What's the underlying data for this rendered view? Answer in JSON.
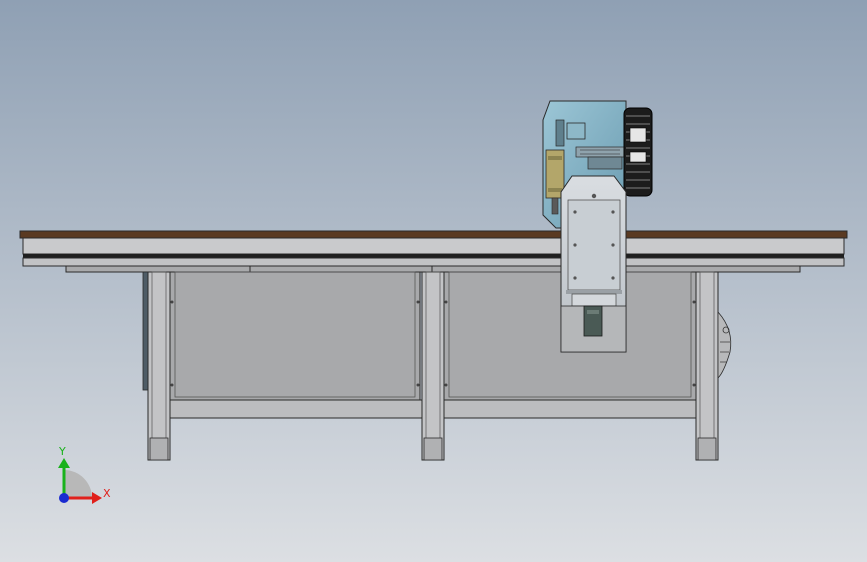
{
  "viewport": {
    "background_top": "#8fa0b4",
    "background_bottom": "#dcdfe3"
  },
  "colors": {
    "table_top": "#5a3a22",
    "frame": "#b9babd",
    "frame_dark": "#8c8d90",
    "panel": "#a8a9ab",
    "outline": "#2a2a2a",
    "head_blue": "#7fb2c6",
    "head_blue_dark": "#5f8fa3",
    "carriage": "#c6ccd2",
    "motor": "#4a5a55",
    "axis_x": "#e0201b",
    "axis_y": "#19b21b",
    "axis_z": "#1a2ad0"
  },
  "axis_triad": {
    "x_label": "X",
    "y_label": "Y",
    "x_icon": "axis-x-arrow-icon",
    "y_icon": "axis-y-arrow-icon",
    "origin_icon": "axis-origin-icon"
  }
}
